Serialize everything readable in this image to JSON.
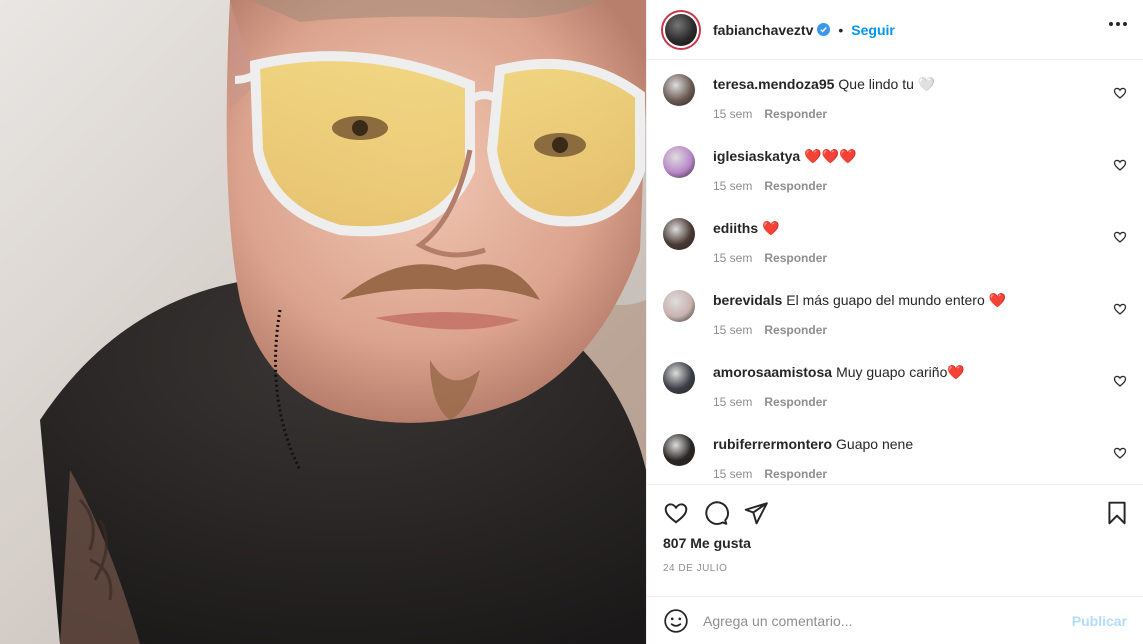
{
  "post": {
    "username": "fabianchaveztv",
    "separator": "•",
    "follow_label": "Seguir",
    "more_icon": "more-options-icon",
    "likes": "807 Me gusta",
    "date": "24 DE JULIO"
  },
  "comments": [
    {
      "user": "teresa.mendoza95",
      "text": "Que lindo tu 🤍",
      "time": "15 sem",
      "reply": "Responder",
      "avatar_color": "#6b5a52"
    },
    {
      "user": "iglesiaskatya",
      "text": "❤️❤️❤️",
      "time": "15 sem",
      "reply": "Responder",
      "avatar_color": "#b987c9"
    },
    {
      "user": "ediiths",
      "text": "❤️",
      "time": "15 sem",
      "reply": "Responder",
      "avatar_color": "#4a3a34"
    },
    {
      "user": "berevidals",
      "text": "El más guapo del mundo entero ❤️",
      "time": "15 sem",
      "reply": "Responder",
      "avatar_color": "#c9b2ae"
    },
    {
      "user": "amorosaamistosa",
      "text": "Muy guapo cariño❤️",
      "time": "15 sem",
      "reply": "Responder",
      "avatar_color": "#3d3f47"
    },
    {
      "user": "rubiferrermontero",
      "text": "Guapo nene",
      "time": "15 sem",
      "reply": "Responder",
      "avatar_color": "#2a2523"
    }
  ],
  "actions": {
    "like_icon": "heart-icon",
    "comment_icon": "comment-bubble-icon",
    "share_icon": "paper-plane-icon",
    "save_icon": "bookmark-icon"
  },
  "add_comment": {
    "placeholder": "Agrega un comentario...",
    "publish_label": "Publicar",
    "emoji_icon": "smiley-icon"
  },
  "colors": {
    "link_blue": "#0095f6",
    "verified_blue": "#3897f0",
    "publish_disabled": "#b3dbff",
    "meta_gray": "#8e8e8e"
  }
}
